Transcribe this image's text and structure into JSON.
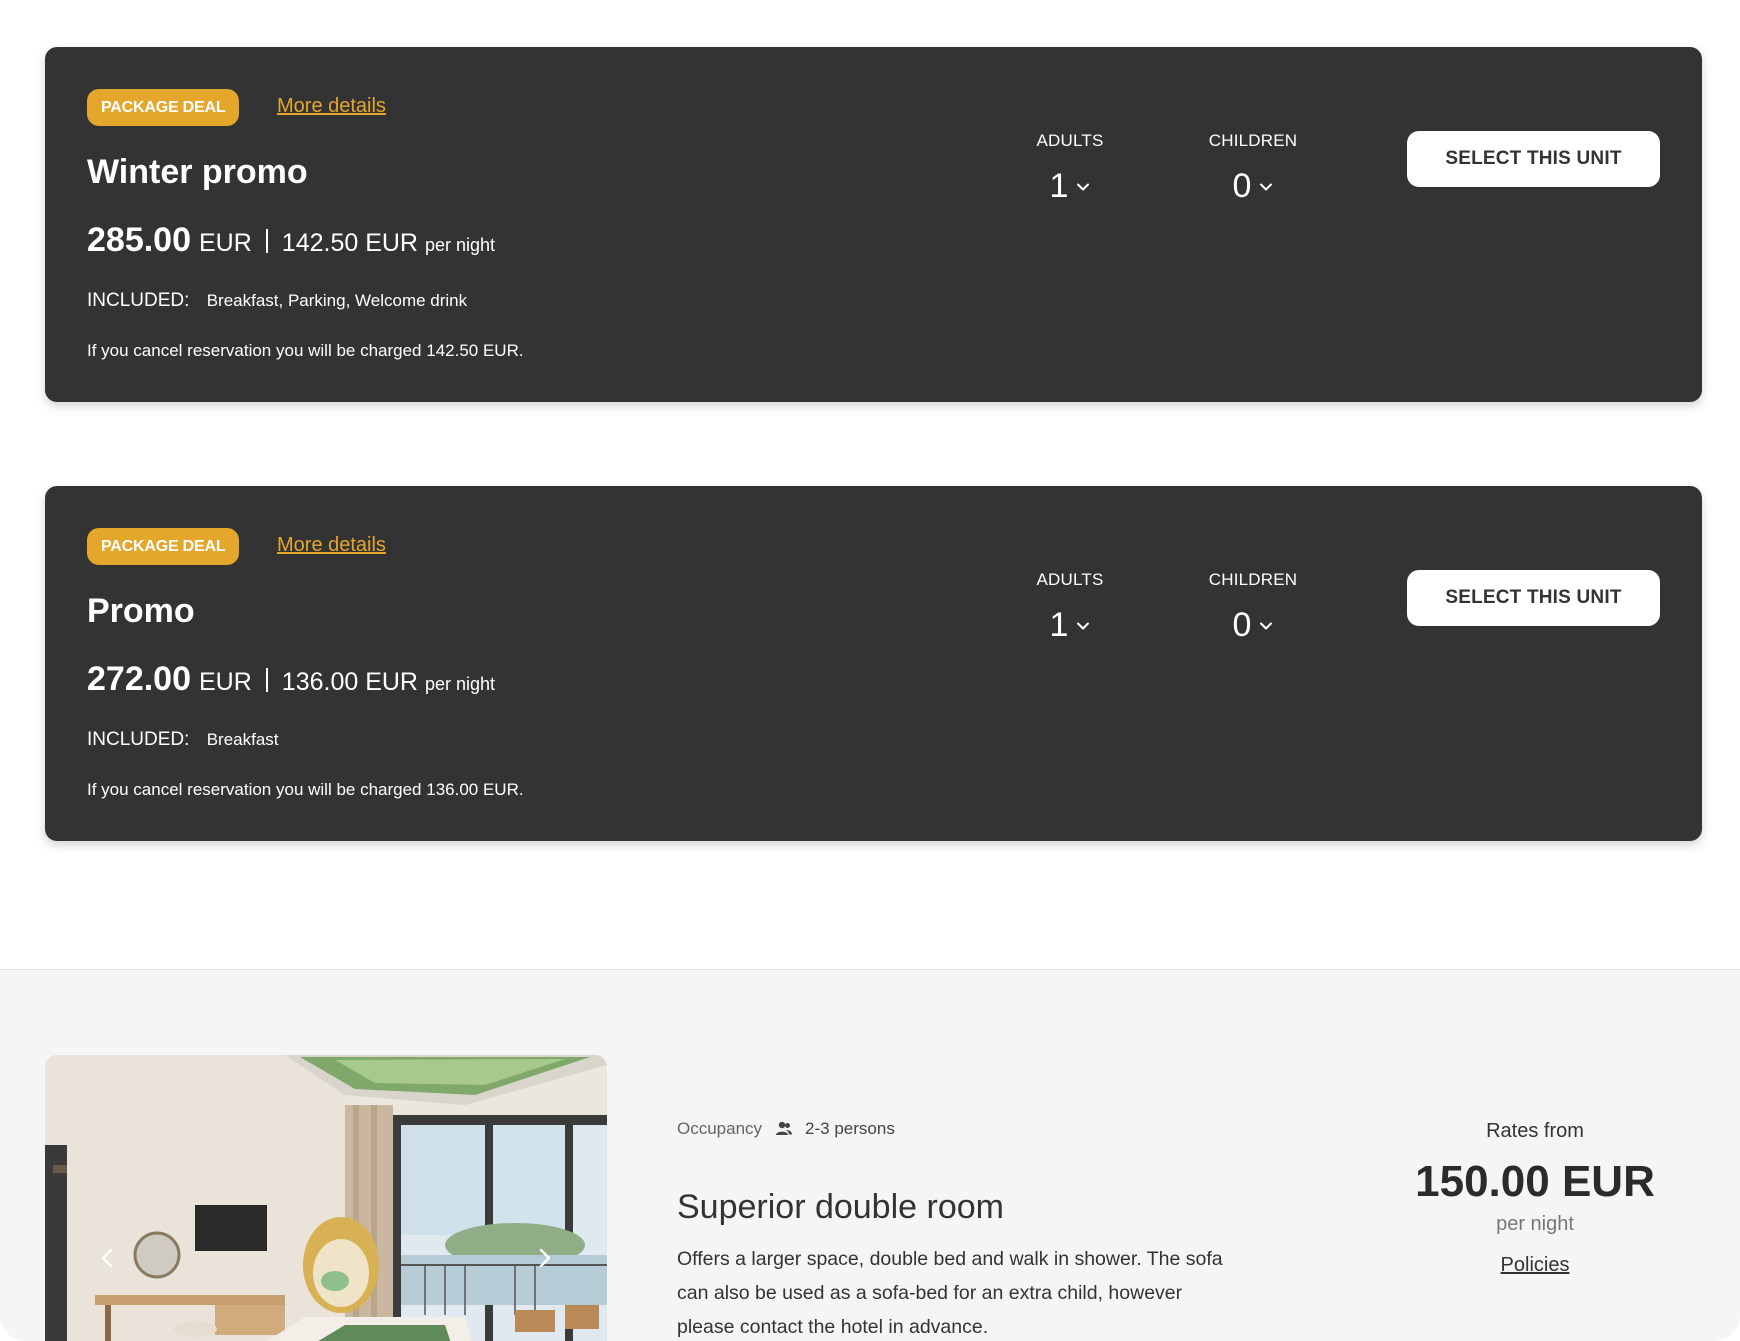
{
  "rates": [
    {
      "badge": "PACKAGE DEAL",
      "more_details": "More details",
      "title": "Winter promo",
      "price_total": "285.00",
      "currency": "EUR",
      "price_night": "142.50 EUR",
      "per_night": "per night",
      "included_label": "INCLUDED:",
      "included_value": "Breakfast, Parking, Welcome drink",
      "cancel_note": "If you cancel reservation you will be charged 142.50 EUR.",
      "adults_label": "ADULTS",
      "adults_value": "1",
      "children_label": "CHILDREN",
      "children_value": "0",
      "select_label": "SELECT THIS UNIT"
    },
    {
      "badge": "PACKAGE DEAL",
      "more_details": "More details",
      "title": "Promo",
      "price_total": "272.00",
      "currency": "EUR",
      "price_night": "136.00 EUR",
      "per_night": "per night",
      "included_label": "INCLUDED:",
      "included_value": "Breakfast",
      "cancel_note": "If you cancel reservation you will be charged 136.00 EUR.",
      "adults_label": "ADULTS",
      "adults_value": "1",
      "children_label": "CHILDREN",
      "children_value": "0",
      "select_label": "SELECT THIS UNIT"
    }
  ],
  "room": {
    "occupancy_label": "Occupancy",
    "occupancy_icon": "persons-icon",
    "occupancy_value": "2-3 persons",
    "title": "Superior double room",
    "description": "Offers a larger space, double bed and walk in shower. The sofa can also be used as a sofa-bed for an extra child, however please contact the hotel in advance.",
    "rates_from_label": "Rates from",
    "rates_from_price": "150.00 EUR",
    "per_night": "per night",
    "policies_label": "Policies"
  },
  "colors": {
    "card_bg": "#333333",
    "accent": "#e4a62b",
    "section_bg": "#f5f5f5"
  }
}
